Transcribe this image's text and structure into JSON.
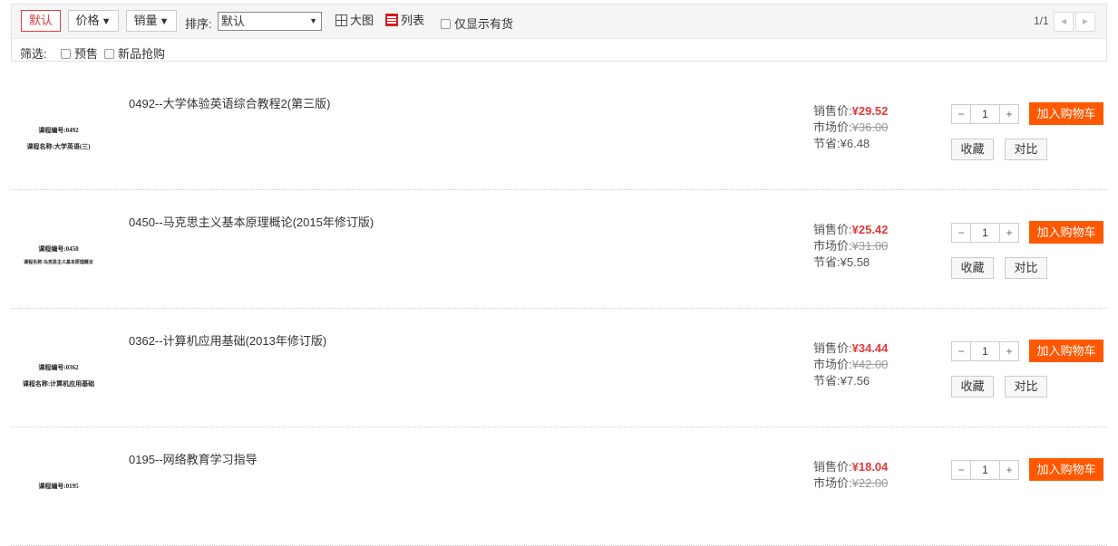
{
  "toolbar": {
    "sort_buttons": [
      {
        "label": "默认",
        "arrow": ""
      },
      {
        "label": "价格",
        "arrow": "🡇"
      },
      {
        "label": "销量",
        "arrow": "🡇"
      }
    ],
    "sort_label": "排序:",
    "sort_select_value": "默认",
    "view_grid_label": "大图",
    "view_list_label": "列表",
    "instock_label": "仅显示有货",
    "page_info": "1/1",
    "filter_label": "筛选:",
    "filters": [
      "预售",
      "新品抢购"
    ]
  },
  "product_labels": {
    "sale": "销售价:",
    "market": "市场价:",
    "save": "节省:",
    "add_to_cart": "加入购物车",
    "favorite": "收藏",
    "compare": "对比",
    "minus": "−",
    "plus": "+"
  },
  "products": [
    {
      "title": "0492--大学体验英语综合教程2(第三版)",
      "cover_line1": "课程编号:0492",
      "cover_line2": "课程名称:大学英语(三)",
      "sale_price": "¥29.52",
      "market_price": "¥36.00",
      "save": "¥6.48",
      "qty": "1"
    },
    {
      "title": "0450--马克思主义基本原理概论(2015年修订版)",
      "cover_line1": "课程编号:0450",
      "cover_line2": "课程名称:马克思主义基本原理概论",
      "sale_price": "¥25.42",
      "market_price": "¥31.00",
      "save": "¥5.58",
      "qty": "1"
    },
    {
      "title": "0362--计算机应用基础(2013年修订版)",
      "cover_line1": "课程编号:0362",
      "cover_line2": "课程名称:计算机应用基础",
      "sale_price": "¥34.44",
      "market_price": "¥42.00",
      "save": "¥7.56",
      "qty": "1"
    },
    {
      "title": "0195--网络教育学习指导",
      "cover_line1": "课程编号:0195",
      "cover_line2": "",
      "sale_price": "¥18.04",
      "market_price": "¥22.00",
      "save": "",
      "qty": "1"
    }
  ]
}
